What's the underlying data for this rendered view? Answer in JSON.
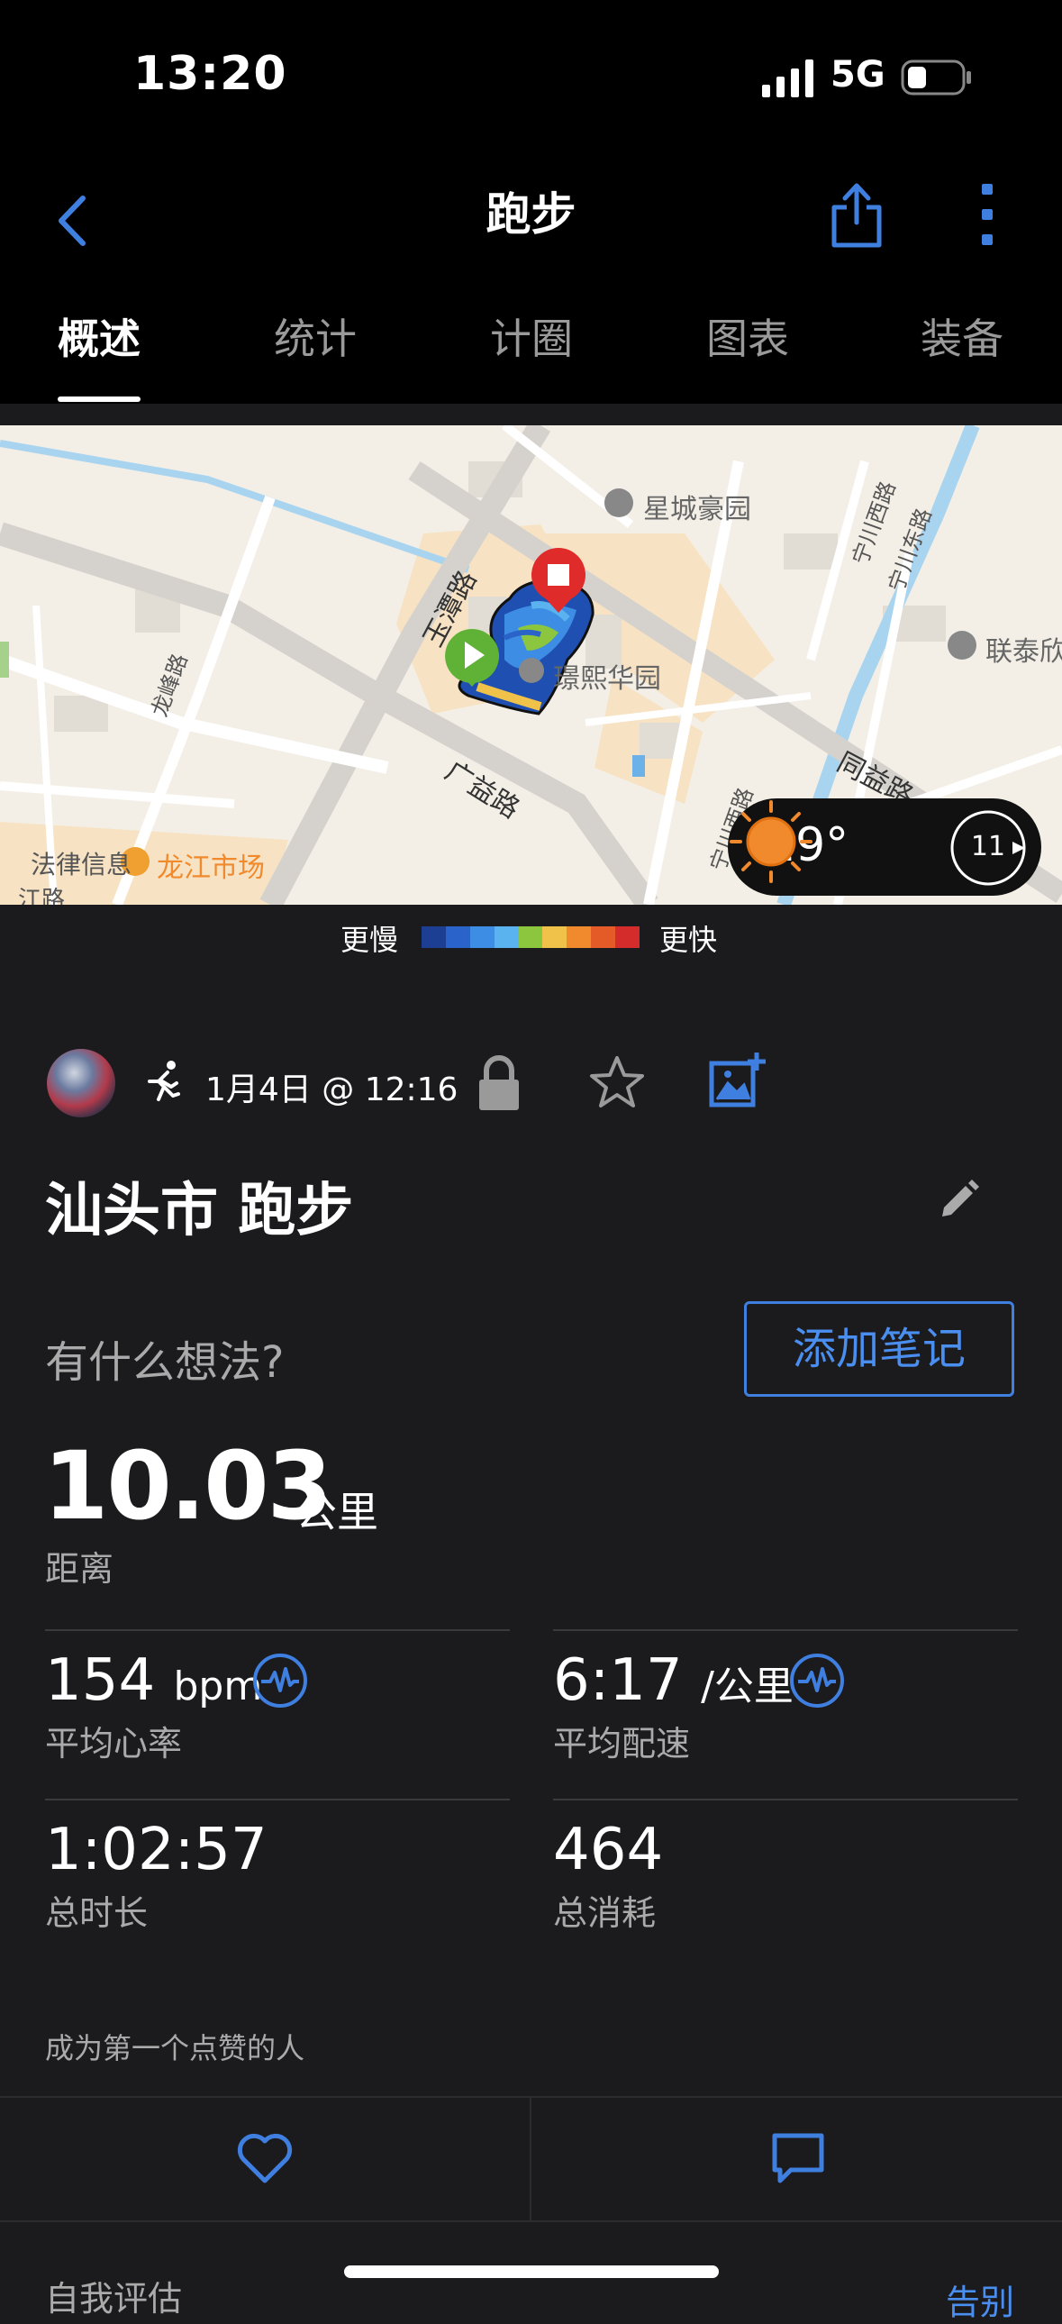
{
  "status_bar": {
    "time": "13:20",
    "network": "5G"
  },
  "nav": {
    "title": "跑步"
  },
  "tabs": [
    {
      "label": "概述"
    },
    {
      "label": "统计"
    },
    {
      "label": "计圈"
    },
    {
      "label": "图表"
    },
    {
      "label": "装备"
    }
  ],
  "map": {
    "labels": {
      "xingcheng": "星城豪园",
      "yuxi": "璟熙华园",
      "liantai": "联泰欣",
      "yutan": "玉潭路",
      "guangyi": "广益路",
      "longjiang_market": "龙江市场",
      "law_info": "法律信息",
      "longfeng": "龙峰路",
      "ningchuan_west": "宁川西路",
      "ningchuan_east": "宁川东路",
      "ningchuan_west2": "宁川西路",
      "tongyi": "同益路",
      "jiang": "江路"
    },
    "weather": {
      "temperature": "19°",
      "wind": "11"
    }
  },
  "legend": {
    "slow": "更慢",
    "fast": "更快",
    "colors": [
      "#1c3f94",
      "#2a63c9",
      "#3d8de4",
      "#5ab2ee",
      "#8cc63f",
      "#f0c24a",
      "#f08a2c",
      "#e55b28",
      "#d42b2b"
    ]
  },
  "activity": {
    "date": "1月4日 @ 12:16",
    "title": "汕头市 跑步",
    "thoughts_placeholder": "有什么想法?",
    "add_note_label": "添加笔记"
  },
  "stats": {
    "distance": {
      "value": "10.03",
      "unit": "公里",
      "label": "距离"
    },
    "heart_rate": {
      "value": "154",
      "unit": "bpm",
      "label": "平均心率"
    },
    "pace": {
      "value": "6:17",
      "unit": "/公里",
      "label": "平均配速"
    },
    "duration": {
      "value": "1:02:57",
      "label": "总时长"
    },
    "calories": {
      "value": "464",
      "label": "总消耗"
    }
  },
  "social": {
    "likes_text": "成为第一个点赞的人"
  },
  "footer": {
    "section_title": "自我评估",
    "peek_link": "告别"
  },
  "colors": {
    "accent": "#3f7fe0",
    "background": "#1b1b1d",
    "start_marker": "#5fb236",
    "end_marker": "#e02b2b"
  }
}
